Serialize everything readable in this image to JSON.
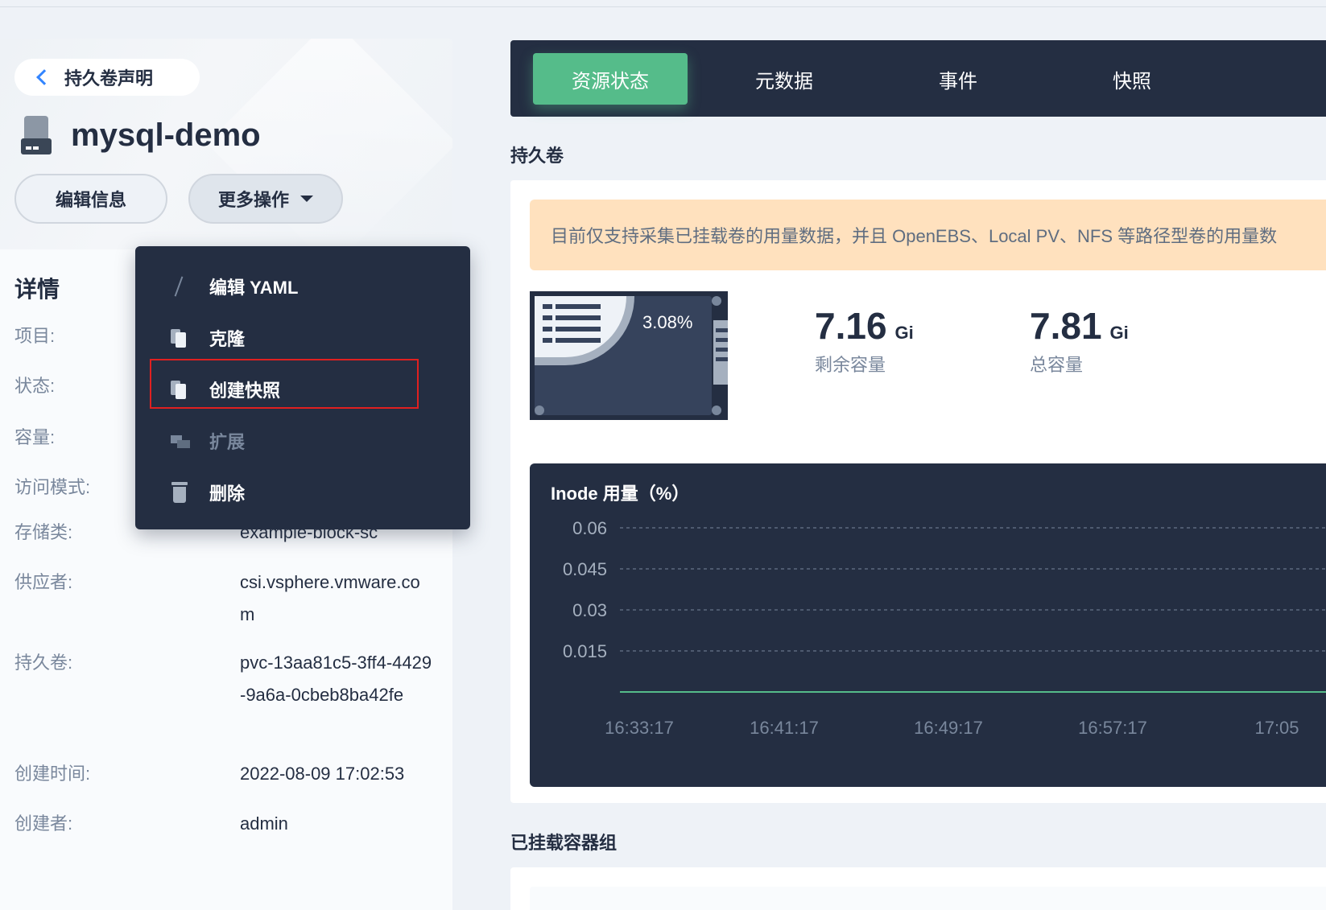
{
  "header": {
    "back_label": "持久卷声明",
    "title": "mysql-demo",
    "edit_button": "编辑信息",
    "more_button": "更多操作"
  },
  "details": {
    "section_title": "详情",
    "rows": [
      {
        "key": "项目:",
        "value": ""
      },
      {
        "key": "状态:",
        "value": ""
      },
      {
        "key": "容量:",
        "value": ""
      },
      {
        "key": "访问模式:",
        "value": ""
      },
      {
        "key": "存储类:",
        "value": "example-block-sc"
      },
      {
        "key": "供应者:",
        "value": "csi.vsphere.vmware.com"
      },
      {
        "key": "持久卷:",
        "value": "pvc-13aa81c5-3ff4-4429-9a6a-0cbeb8ba42fe"
      },
      {
        "key": "创建时间:",
        "value": "2022-08-09 17:02:53"
      },
      {
        "key": "创建者:",
        "value": "admin"
      }
    ]
  },
  "dropdown": {
    "items": [
      {
        "label": "编辑 YAML",
        "icon": "pencil-icon",
        "disabled": false
      },
      {
        "label": "克隆",
        "icon": "copy-icon",
        "disabled": false
      },
      {
        "label": "创建快照",
        "icon": "snapshot-icon",
        "disabled": false
      },
      {
        "label": "扩展",
        "icon": "expand-icon",
        "disabled": true
      },
      {
        "label": "删除",
        "icon": "trash-icon",
        "disabled": false
      }
    ]
  },
  "tabs": [
    {
      "label": "资源状态",
      "active": true
    },
    {
      "label": "元数据",
      "active": false
    },
    {
      "label": "事件",
      "active": false
    },
    {
      "label": "快照",
      "active": false
    }
  ],
  "volume": {
    "section_title": "持久卷",
    "notice": "目前仅支持采集已挂载卷的用量数据，并且 OpenEBS、Local PV、NFS 等路径型卷的用量数",
    "usage_percent": "3.08%",
    "remaining": {
      "value": "7.16",
      "unit": "Gi",
      "label": "剩余容量"
    },
    "total": {
      "value": "7.81",
      "unit": "Gi",
      "label": "总容量"
    }
  },
  "mounted_section_title": "已挂载容器组",
  "colors": {
    "accent_green": "#55bc8a",
    "dark_bg": "#242e42",
    "notice_bg": "#ffe1be",
    "highlight_red": "#e02020"
  },
  "chart_data": {
    "type": "line",
    "title": "Inode 用量（%）",
    "x": [
      "16:33:17",
      "16:41:17",
      "16:49:17",
      "16:57:17",
      "17:05"
    ],
    "y_ticks": [
      "0.06",
      "0.045",
      "0.03",
      "0.015"
    ],
    "ylim": [
      0,
      0.06
    ],
    "series": [
      {
        "values": [
          0,
          0,
          0,
          0,
          0
        ]
      }
    ],
    "grid": true
  }
}
